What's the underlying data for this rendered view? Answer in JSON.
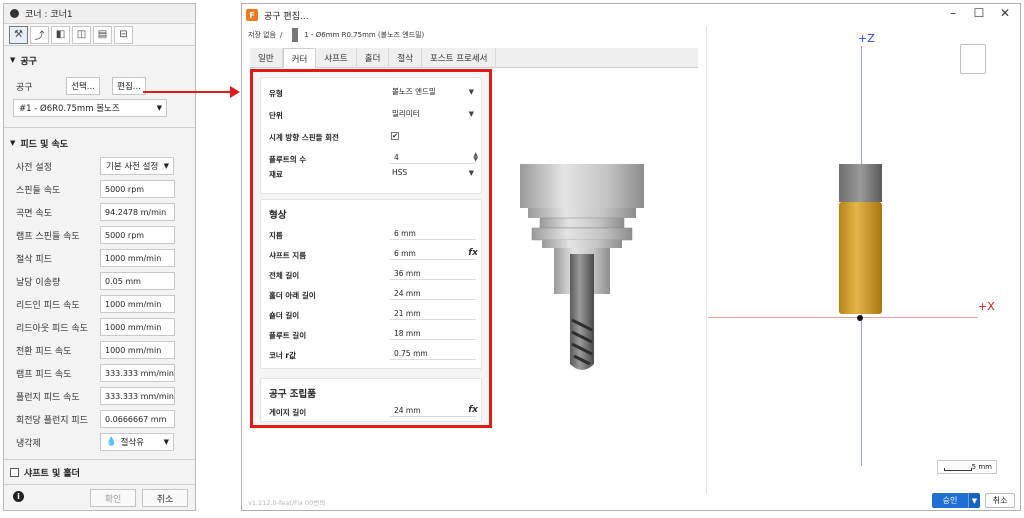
{
  "left_panel": {
    "title": "코너 : 코너1",
    "tab_icons": [
      "tool-icon",
      "path-icon",
      "geometry-icon",
      "height-icon",
      "passes-icon",
      "linking-icon"
    ],
    "tool_section": {
      "header": "공구",
      "tool_label": "공구",
      "select_button": "선택...",
      "edit_button": "편집...",
      "tool_value": "#1 - Ø6R0.75mm 볼노즈"
    },
    "feed_section": {
      "header": "피드 및 속도",
      "rows": [
        {
          "label": "사전 설정",
          "value": "기본 사전 설정",
          "type": "select"
        },
        {
          "label": "스핀들 속도",
          "value": "5000 rpm",
          "type": "input"
        },
        {
          "label": "곡면 속도",
          "value": "94.2478 m/min",
          "type": "input"
        },
        {
          "label": "램프 스핀들 속도",
          "value": "5000 rpm",
          "type": "input"
        },
        {
          "label": "절삭 피드",
          "value": "1000 mm/min",
          "type": "input"
        },
        {
          "label": "날당 이송량",
          "value": "0.05 mm",
          "type": "input"
        },
        {
          "label": "리드인 피드 속도",
          "value": "1000 mm/min",
          "type": "input"
        },
        {
          "label": "리드아웃 피드 속도",
          "value": "1000 mm/min",
          "type": "input"
        },
        {
          "label": "전환 피드 속도",
          "value": "1000 mm/min",
          "type": "input"
        },
        {
          "label": "램프 피드 속도",
          "value": "333.333 mm/min",
          "type": "input"
        },
        {
          "label": "플런지 피드 속도",
          "value": "333.333 mm/min",
          "type": "input"
        },
        {
          "label": "회전당 플런지 피드",
          "value": "0.0666667 mm",
          "type": "input"
        },
        {
          "label": "냉각제",
          "value": "절삭유",
          "type": "select"
        }
      ]
    },
    "shaft_section": {
      "header": "샤프트 및 홀더"
    },
    "footer": {
      "ok": "확인",
      "cancel": "취소"
    }
  },
  "dialog": {
    "title": "공구 편집...",
    "breadcrumb": {
      "library": "저장 없음",
      "separator": "/",
      "tool": "1 - Ø6mm R0.75mm (볼노즈 엔드밀)"
    },
    "tabs": [
      "일반",
      "커터",
      "샤프트",
      "홀더",
      "절삭",
      "포스트 프로세서"
    ],
    "active_tab": "커터",
    "cutter": {
      "type": {
        "label": "유형",
        "value": "볼노즈 엔드밀"
      },
      "unit": {
        "label": "단위",
        "value": "밀리미터"
      },
      "cw": {
        "label": "시계 방향 스핀들 회전",
        "checked": "✔"
      },
      "flutes": {
        "label": "플루트의 수",
        "value": "4"
      },
      "material": {
        "label": "재료",
        "value": "HSS"
      }
    },
    "geometry": {
      "title": "형상",
      "fields": [
        {
          "label": "지름",
          "value": "6 mm",
          "fx": false
        },
        {
          "label": "샤프트 지름",
          "value": "6 mm",
          "fx": true
        },
        {
          "label": "전체 길이",
          "value": "36 mm",
          "fx": false
        },
        {
          "label": "홀더 아래 길이",
          "value": "24 mm",
          "fx": false
        },
        {
          "label": "숄더 길이",
          "value": "21 mm",
          "fx": false
        },
        {
          "label": "플루트 길이",
          "value": "18 mm",
          "fx": false
        },
        {
          "label": "코너 r값",
          "value": "0.75 mm",
          "fx": false
        }
      ]
    },
    "assembly": {
      "title": "공구 조립품",
      "gauge": {
        "label": "게이지 길이",
        "value": "24 mm"
      }
    },
    "fx_symbol": "fx",
    "version": "v1.112.0-feat/Fix 00번의",
    "viewport": {
      "axis_z": "+Z",
      "axis_x": "+X",
      "scale": "5 mm"
    },
    "buttons": {
      "ok": "승인",
      "cancel": "취소"
    }
  }
}
